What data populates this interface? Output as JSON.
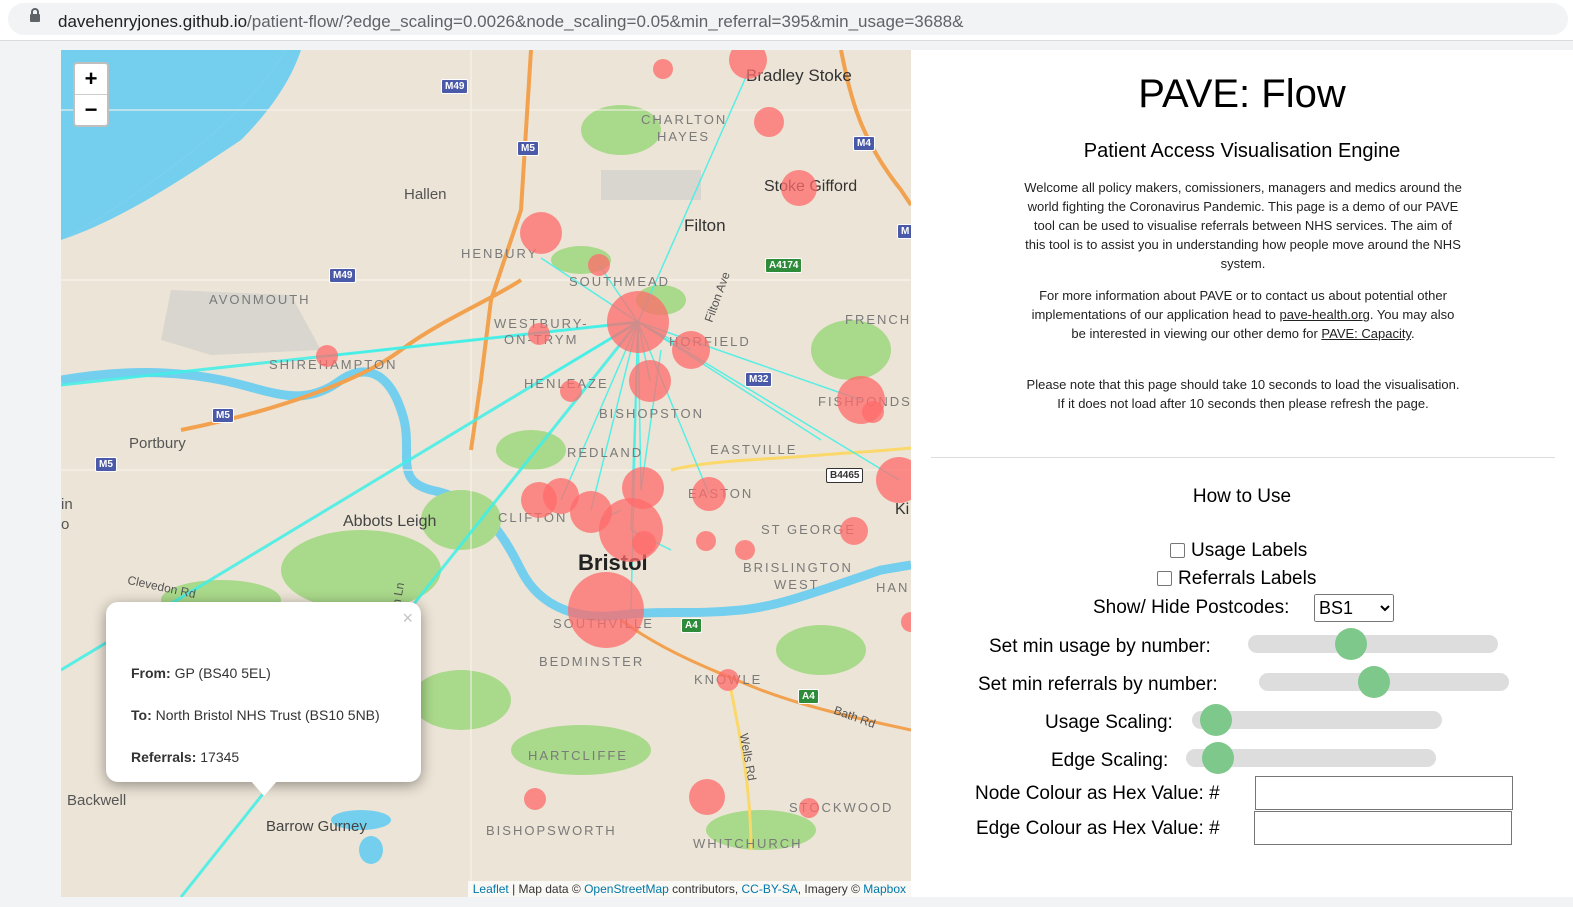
{
  "browser": {
    "url_host": "davehenryjones.github.io",
    "url_path": "/patient-flow/?edge_scaling=0.0026&node_scaling=0.05&min_referral=395&min_usage=3688&"
  },
  "map": {
    "zoom_in": "+",
    "zoom_out": "−",
    "places": {
      "bradley_stoke": "Bradley Stoke",
      "charlton": "CHARLTON",
      "hayes": "HAYES",
      "stoke_gifford": "Stoke Gifford",
      "hallen": "Hallen",
      "filton": "Filton",
      "henbury": "HENBURY",
      "southmead": "SOUTHMEAD",
      "avonmouth": "AVONMOUTH",
      "westbury": "WESTBURY-",
      "on_trym": "ON-TRYM",
      "horfield": "HORFIELD",
      "frenchay": "FRENCHA",
      "shirehampton": "SHIREHAMPTON",
      "henleaze": "HENLEAZE",
      "fishponds": "FISHPONDS",
      "bishopston": "BISHOPSTON",
      "portbury": "Portbury",
      "redland": "REDLAND",
      "eastville": "EASTVILLE",
      "easton": "EASTON",
      "abbots_leigh": "Abbots Leigh",
      "clifton": "CLIFTON",
      "st_george": "ST GEORGE",
      "bristol": "Bristol",
      "brislington": "BRISLINGTON",
      "west": "WEST",
      "clevedon_rd": "Clevedon Rd",
      "southville": "SOUTHVILLE",
      "bedminster": "BEDMINSTER",
      "knowle": "KNOWLE",
      "bath_rd": "Bath Rd",
      "wells_rd": "Wells Rd",
      "hartcliffe": "HARTCLIFFE",
      "backwell": "Backwell",
      "barrow_gurney": "Barrow Gurney",
      "stockwood": "STOCKWOOD",
      "bishopsworth": "BISHOPSWORTH",
      "whitchurch": "WHITCHURCH",
      "filton_ave": "Filton Ave",
      "ash_ln": "sh Ln",
      "kin": "Ki",
      "han": "HAN",
      "left_in": "in",
      "left_o": "o"
    },
    "shields": {
      "m49a": "M49",
      "m5a": "M5",
      "m4": "M4",
      "m49b": "M49",
      "a4174": "A4174",
      "m32": "M32",
      "m5b": "M5",
      "m5c": "M5",
      "b4465": "B4465",
      "a4a": "A4",
      "a4b": "A4",
      "m_edge": "M"
    },
    "attribution": {
      "leaflet": "Leaflet",
      "sep1": " | Map data © ",
      "osm": "OpenStreetMap",
      "sep2": " contributors, ",
      "license": "CC-BY-SA",
      "sep3": ", Imagery © ",
      "mapbox": "Mapbox"
    },
    "node_color": "#ff6b6b",
    "edge_color": "#3ff0e8"
  },
  "popup": {
    "close": "×",
    "from_label": "From:",
    "from_value": "GP (BS40 5EL)",
    "to_label": "To:",
    "to_value": "North Bristol NHS Trust (BS10 5NB)",
    "referrals_label": "Referrals:",
    "referrals_value": "17345"
  },
  "panel": {
    "title": "PAVE: Flow",
    "subtitle": "Patient Access Visualisation Engine",
    "welcome": "Welcome all policy makers, comissioners, managers and medics around the world fighting the Coronavirus Pandemic. This page is a demo of our PAVE tool can be used to visualise referrals between NHS services. The aim of this tool is to assist you in understanding how people move around the NHS system.",
    "info_before": "For more information about PAVE or to contact us about potential other implementations of our application head to ",
    "info_link1": "pave-health.org",
    "info_mid": ". You may also be interested in viewing our other demo for ",
    "info_link2": "PAVE: Capacity",
    "info_after": ".",
    "note": "Please note that this page should take 10 seconds to load the visualisation. If it does not load after 10 seconds then please refresh the page.",
    "how_to_use": "How to Use",
    "usage_labels": "Usage Labels",
    "referrals_labels": "Referrals Labels",
    "postcodes_label": "Show/ Hide Postcodes:",
    "postcode_selected": "BS1",
    "min_usage_label": "Set min usage by number:",
    "min_usage_value": 3688,
    "min_referrals_label": "Set min referrals by number:",
    "min_referrals_value": 395,
    "usage_scaling_label": "Usage Scaling:",
    "usage_scaling_value": 0.05,
    "edge_scaling_label": "Edge Scaling:",
    "edge_scaling_value": 0.0026,
    "node_colour_label": "Node Colour as Hex Value:",
    "edge_colour_label": "Edge Colour as Hex Value:",
    "hash": "#",
    "accent": "#7ec88b"
  }
}
